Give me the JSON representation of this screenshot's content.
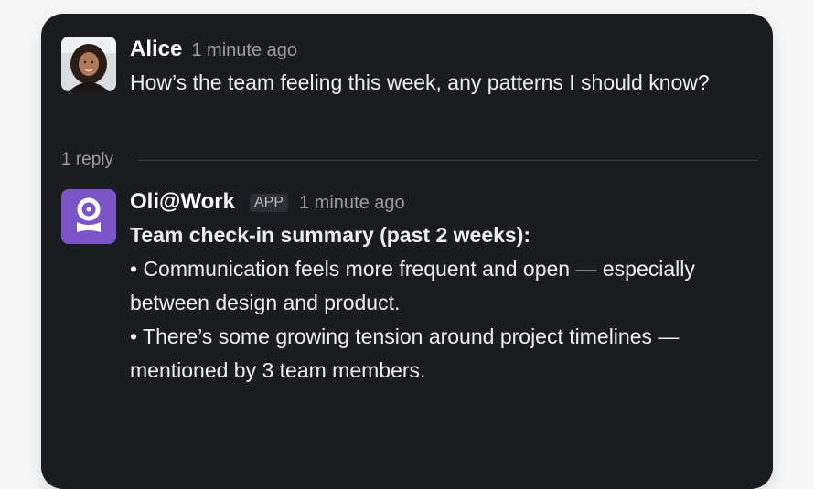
{
  "thread": {
    "parent": {
      "author": "Alice",
      "timestamp": "1 minute ago",
      "text": "How’s the team feeling this week, any patterns I should know?"
    },
    "reply_count": "1 reply",
    "reply": {
      "author": "Oli@Work",
      "badge": "APP",
      "timestamp": "1 minute ago",
      "heading": "Team check-in summary (past 2 weeks):",
      "bullets": [
        "• Communication feels more frequent and open — especially between design and product.",
        "• There’s some growing tension around project timelines — mentioned by 3 team members."
      ]
    }
  },
  "colors": {
    "panel_background": "#1b1c1f",
    "bot_avatar": "#7b55c7",
    "text_primary": "#eceef1",
    "text_muted": "#9a9ca1"
  },
  "icons": {
    "alice_avatar": "user-photo-avatar",
    "bot_avatar": "oli-bot-icon"
  }
}
